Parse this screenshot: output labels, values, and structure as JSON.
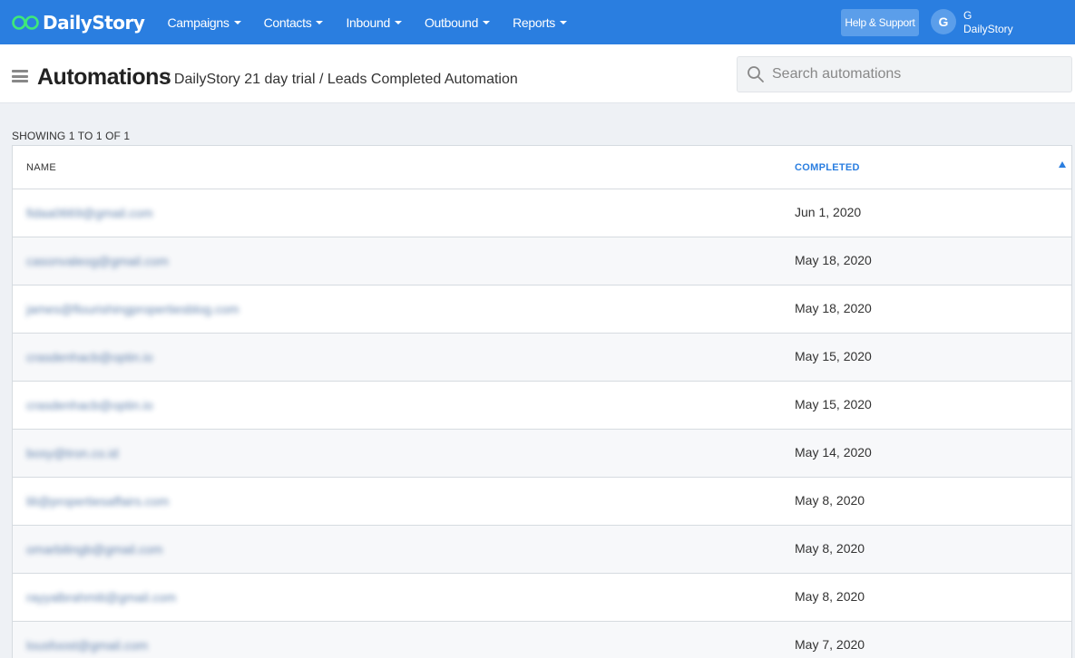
{
  "brand": {
    "name": "DailyStory"
  },
  "nav": {
    "items": [
      {
        "label": "Campaigns"
      },
      {
        "label": "Contacts"
      },
      {
        "label": "Inbound"
      },
      {
        "label": "Outbound"
      },
      {
        "label": "Reports"
      }
    ],
    "help_label": "Help & Support",
    "avatar_initial": "G",
    "user_name": "G",
    "user_org": "DailyStory"
  },
  "header": {
    "title": "Automations",
    "breadcrumb": "/ DailyStory 21 day trial / Leads Completed Automation",
    "search_placeholder": "Search automations"
  },
  "list": {
    "showing": "SHOWING 1 TO 1 OF 1",
    "columns": {
      "name": "NAME",
      "completed": "COMPLETED"
    },
    "rows": [
      {
        "name": "fidaa0669@gmail.com",
        "completed": "Jun 1, 2020"
      },
      {
        "name": "casonvaleog@gmail.com",
        "completed": "May 18, 2020"
      },
      {
        "name": "james@flourishingpropertiesblog.com",
        "completed": "May 18, 2020"
      },
      {
        "name": "crasdenhacb@optin.io",
        "completed": "May 15, 2020"
      },
      {
        "name": "crasdenhacb@optin.io",
        "completed": "May 15, 2020"
      },
      {
        "name": "bosy@tron.co.id",
        "completed": "May 14, 2020"
      },
      {
        "name": "lili@propertiesaffairs.com",
        "completed": "May 8, 2020"
      },
      {
        "name": "omarbilingb@gmail.com",
        "completed": "May 8, 2020"
      },
      {
        "name": "rayyalbrahmiti@gmail.com",
        "completed": "May 8, 2020"
      },
      {
        "name": "lousfoost@gmail.com",
        "completed": "May 7, 2020"
      }
    ]
  },
  "colors": {
    "nav_bg": "#2a7ee0",
    "accent": "#2a7ee0",
    "logo_green": "#3ee87a"
  }
}
